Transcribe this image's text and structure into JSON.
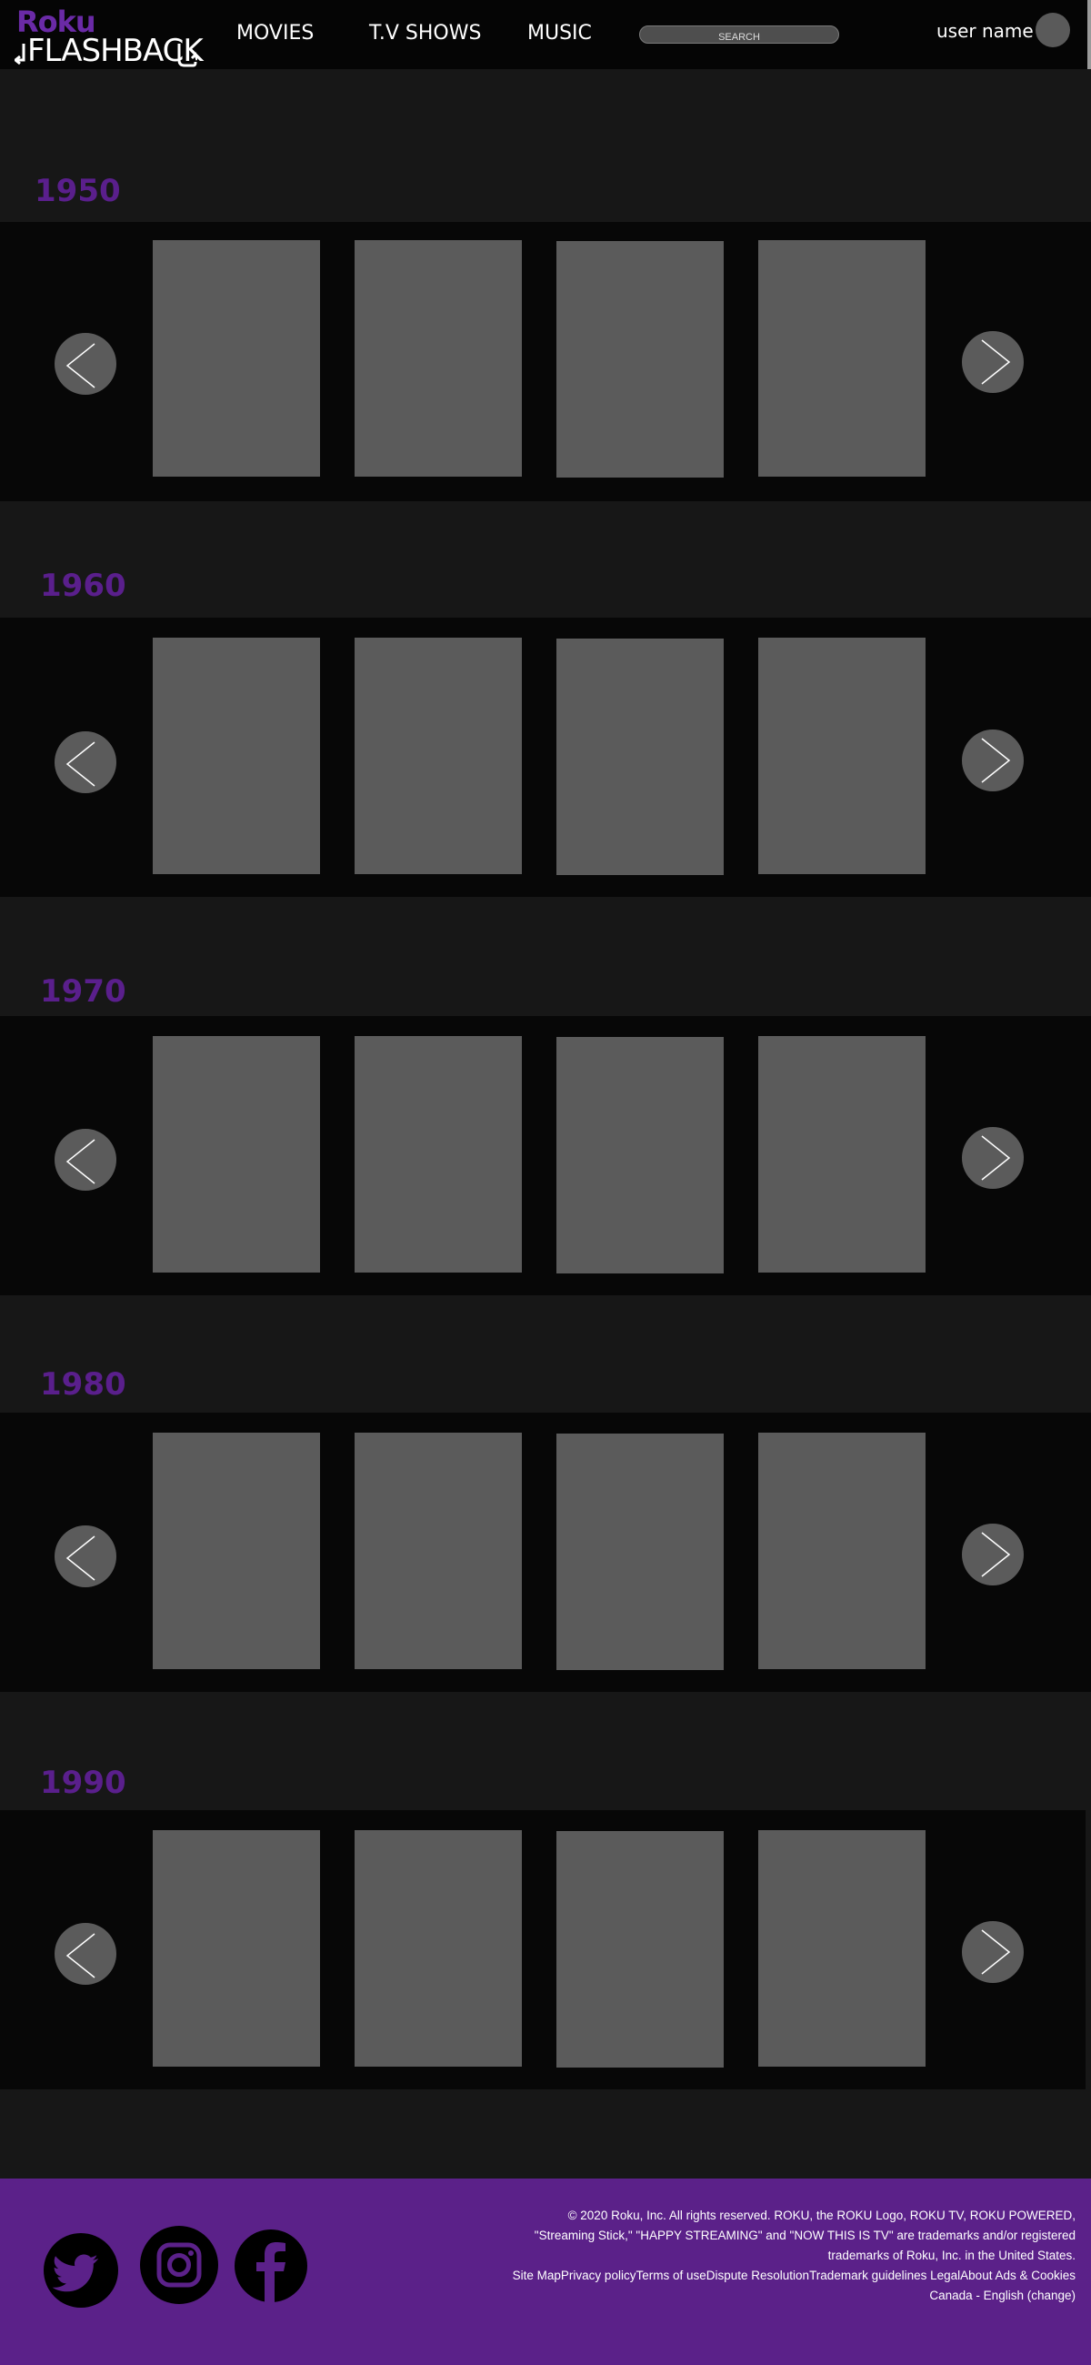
{
  "header": {
    "logo_roku": "Roku",
    "logo_flashback": "FLASHBACK",
    "nav": [
      "MOVIES",
      "T.V SHOWS",
      "MUSIC"
    ],
    "search_placeholder": "SEARCH",
    "user_name": "user name"
  },
  "decades": [
    {
      "title": "1950",
      "posters": 4
    },
    {
      "title": "1960",
      "posters": 4
    },
    {
      "title": "1970",
      "posters": 4
    },
    {
      "title": "1980",
      "posters": 4
    },
    {
      "title": "1990",
      "posters": 4
    }
  ],
  "footer": {
    "legal_line1": "© 2020 Roku, Inc. All rights reserved. ROKU, the ROKU Logo, ROKU TV, ROKU POWERED, \"Streaming Stick,\" \"HAPPY STREAMING\" and \"NOW THIS IS TV\" are trademarks and/or registered trademarks of Roku, Inc. in the United States.",
    "links": [
      "Site Map",
      "Privacy policy",
      "Terms of use",
      "Dispute Resolution",
      "Trademark guidelines",
      " Legal",
      "About Ads & Cookies"
    ],
    "locale": "Canada - English (change)",
    "social_icons": [
      "twitter-icon",
      "instagram-icon",
      "facebook-icon"
    ]
  },
  "colors": {
    "accent": "#5b2189",
    "decade_title": "#5a1f8c",
    "poster": "#5b5b5b",
    "page_bg": "#171717",
    "carousel_bg": "#070707"
  }
}
